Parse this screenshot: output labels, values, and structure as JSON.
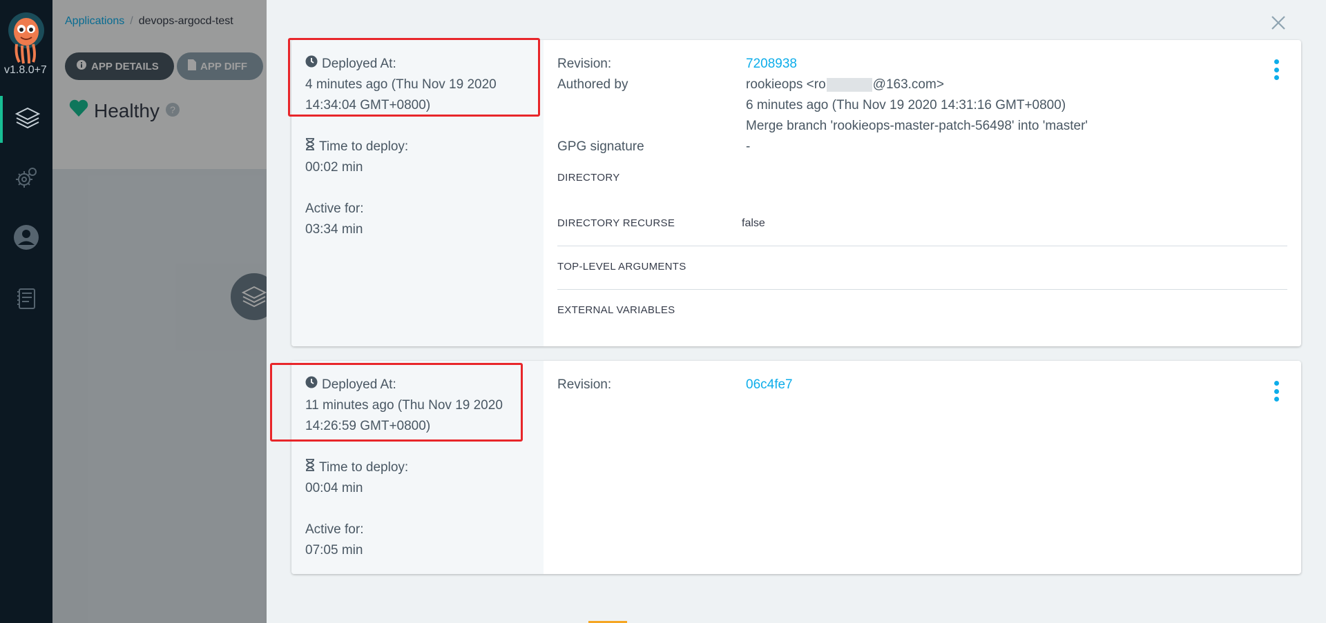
{
  "nav": {
    "version": "v1.8.0+7",
    "items": [
      "applications",
      "settings",
      "user-info",
      "documentation"
    ]
  },
  "app": {
    "breadcrumb_root": "Applications",
    "breadcrumb_sep": "/",
    "breadcrumb_current": "devops-argocd-test",
    "btn_details": "APP DETAILS",
    "btn_diff": "APP DIFF",
    "health": "Healthy"
  },
  "history": [
    {
      "deployed_at_label": "Deployed At:",
      "deployed_at_line1": "4 minutes ago (Thu Nov 19 2020",
      "deployed_at_line2": "14:34:04 GMT+0800)",
      "time_to_deploy_label": "Time to deploy:",
      "time_to_deploy": "00:02 min",
      "active_for_label": "Active for:",
      "active_for": "03:34 min",
      "revision_label": "Revision:",
      "revision": "7208938",
      "authored_by_label": "Authored by",
      "author_prefix": "rookieops <ro",
      "author_suffix": "@163.com>",
      "commit_date": "6 minutes ago (Thu Nov 19 2020 14:31:16 GMT+0800)",
      "commit_message": "Merge branch 'rookieops-master-patch-56498' into 'master'",
      "gpg_label": "GPG signature",
      "gpg_value": "-",
      "directory_label": "DIRECTORY",
      "directory_recurse_label": "DIRECTORY RECURSE",
      "directory_recurse_value": "false",
      "top_level_args_label": "TOP-LEVEL ARGUMENTS",
      "external_vars_label": "EXTERNAL VARIABLES"
    },
    {
      "deployed_at_label": "Deployed At:",
      "deployed_at_line1": "11 minutes ago (Thu Nov 19 2020",
      "deployed_at_line2": "14:26:59 GMT+0800)",
      "time_to_deploy_label": "Time to deploy:",
      "time_to_deploy": "00:04 min",
      "active_for_label": "Active for:",
      "active_for": "07:05 min",
      "revision_label": "Revision:",
      "revision": "06c4fe7"
    }
  ],
  "colors": {
    "accent": "#0dadea",
    "healthy": "#18be94",
    "highlight": "#e8262a"
  }
}
